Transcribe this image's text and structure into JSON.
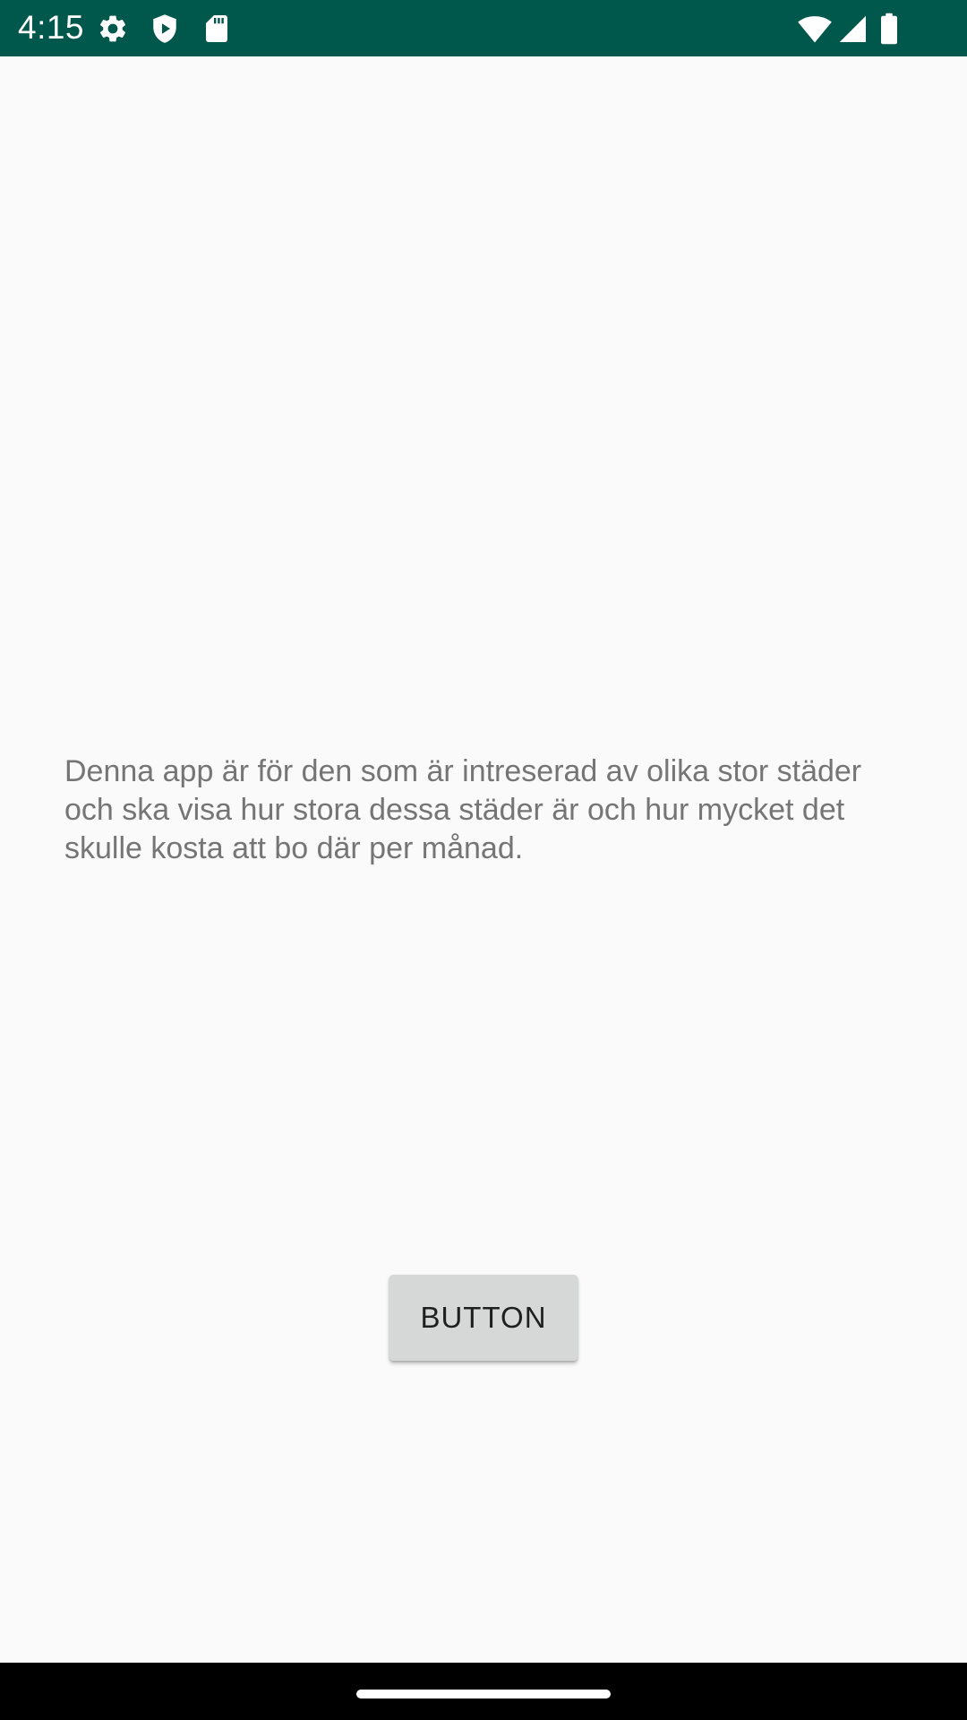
{
  "status_bar": {
    "time": "4:15",
    "background_color": "#00574b",
    "left_icons": [
      "gear-icon",
      "shield-icon",
      "sd-card-icon"
    ],
    "right_icons": [
      "wifi-icon",
      "signal-icon",
      "battery-icon"
    ]
  },
  "main": {
    "description": "Denna app är för den som är intreserad av olika stor städer och ska visa hur stora dessa städer är och hur mycket det skulle kosta att bo där per månad.",
    "button_label": "BUTTON"
  },
  "nav_bar": {
    "handle": "home-handle"
  }
}
